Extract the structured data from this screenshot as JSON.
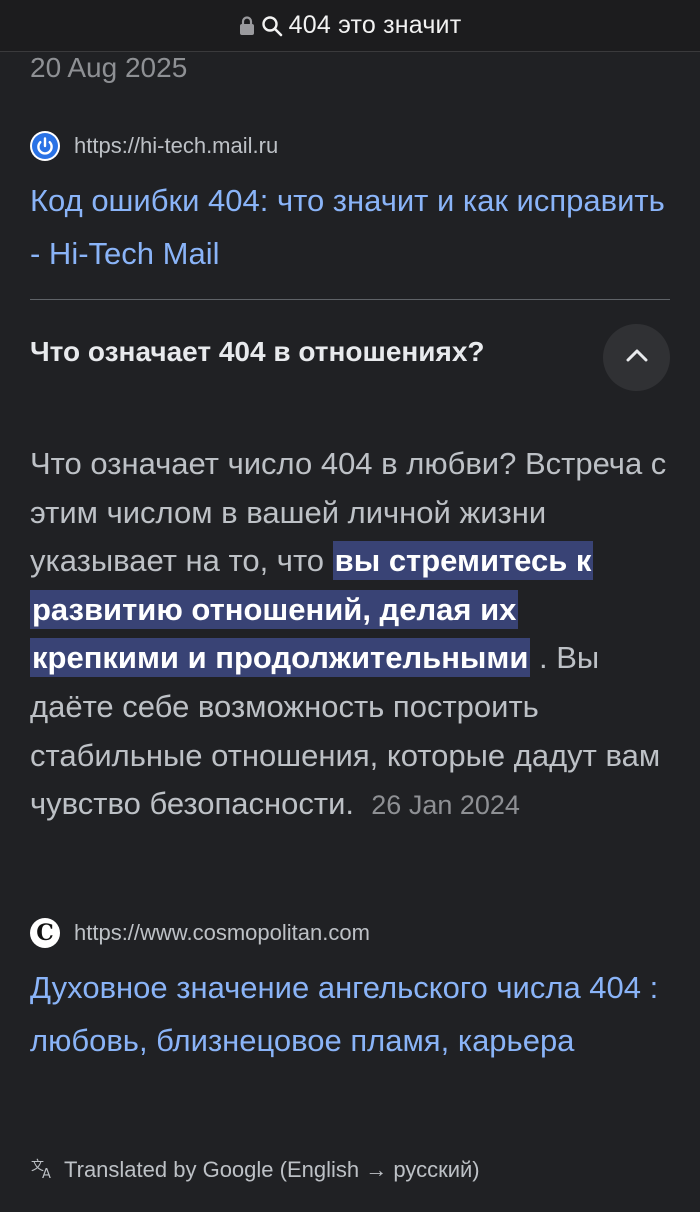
{
  "address_bar": {
    "query": "404 это значит"
  },
  "previous_result": {
    "date": "20 Aug 2025",
    "source_url": "https://hi-tech.mail.ru",
    "title": "Код ошибки 404: что значит и как исправить - Hi-Tech Mail"
  },
  "faq": {
    "question": "Что означает 404 в отношениях?",
    "expanded": true,
    "answer_before": "Что означает число 404 в любви? Встреча с этим числом в вашей личной жизни указывает на то, что ",
    "answer_highlight": "вы стремитесь к развитию отношений, делая их крепкими и продолжительными",
    "answer_after": " . Вы даёте себе возможность построить стабильные отношения, которые дадут вам чувство безопасности.",
    "answer_date": "26 Jan 2024"
  },
  "source_result": {
    "source_url": "https://www.cosmopolitan.com",
    "favicon_letter": "C",
    "title": "Духовное значение ангельского числа 404 : любовь, близнецовое пламя, карьера"
  },
  "footer": {
    "translated_note": "Translated by Google (English → русский)"
  },
  "icons": {
    "lock": "lock-icon",
    "search": "search-icon",
    "collapse": "chevron-up-icon",
    "translate": "translate-icon"
  },
  "colors": {
    "background": "#202124",
    "link": "#8ab4f8",
    "highlight": "#394375",
    "muted_text": "#bdc1c6"
  }
}
